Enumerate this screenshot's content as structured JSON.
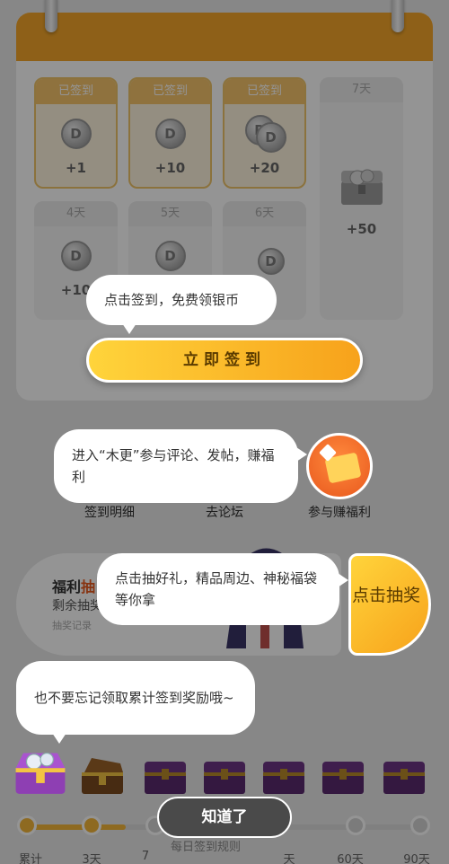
{
  "calendar": {
    "days": [
      {
        "tag": "已签到",
        "amount": "+1",
        "state": "signed"
      },
      {
        "tag": "已签到",
        "amount": "+10",
        "state": "signed"
      },
      {
        "tag": "已签到",
        "amount": "+20",
        "state": "signed"
      },
      {
        "tag": "7天",
        "amount": "+50",
        "state": "pending"
      },
      {
        "tag": "4天",
        "amount": "+10",
        "state": "pending"
      },
      {
        "tag": "5天",
        "amount": "",
        "state": "pending"
      },
      {
        "tag": "6天",
        "amount": "",
        "state": "pending"
      }
    ],
    "coin_glyph": "D",
    "sign_button": "立即签到"
  },
  "entries": {
    "detail": "签到明细",
    "forum": "去论坛",
    "welfare": "参与赚福利"
  },
  "lottery": {
    "title_prefix": "福利",
    "title_highlight": "抽",
    "remaining": "剩余抽奖",
    "records": "抽奖记录",
    "draw_button": "点击抽奖"
  },
  "progress": {
    "labels": [
      "累计",
      "3天",
      "7",
      "天",
      "60天",
      "90天"
    ],
    "rules": "每日签到规则",
    "filled_fraction": 0.25
  },
  "tips": {
    "sign": "点击签到，免费领银币",
    "forum": "进入“木更”参与评论、发帖，赚福利",
    "lottery": "点击抽好礼，精品周边、神秘福袋等你拿",
    "cumulative": "也不要忘记领取累计签到奖励哦~"
  },
  "got_it": "知道了",
  "colors": {
    "accent": "#f7a21b",
    "header": "#f4a62a",
    "highlight": "#e8581d"
  }
}
